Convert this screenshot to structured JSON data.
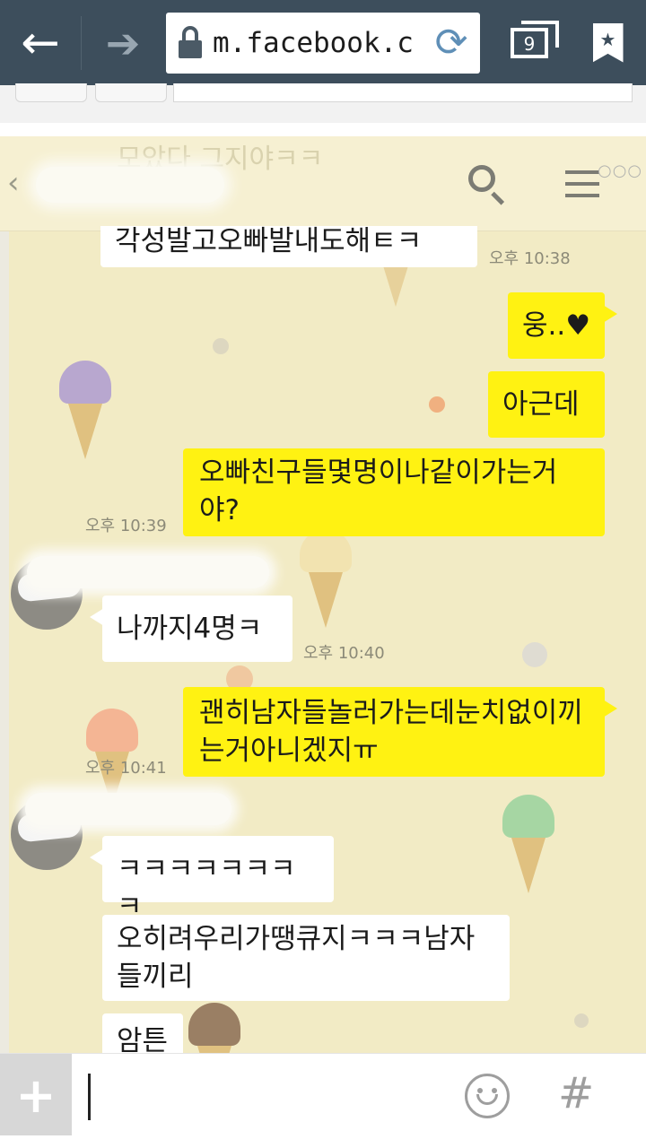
{
  "browser": {
    "url": "m.facebook.c",
    "tab_count": "9",
    "back_icon": "←",
    "forward_icon": "➔",
    "reload_icon": "⟳"
  },
  "chat": {
    "header": {
      "back_icon": "‹",
      "ghost_text": "모았다 그지야ㅋㅋ",
      "dots": "○○○"
    },
    "messages": [
      {
        "side": "left",
        "text": "각성발고오빠발내도해ㅌㅋ",
        "time": "오후 10:38"
      },
      {
        "side": "right",
        "text": "웅..♥"
      },
      {
        "side": "right",
        "text": "아근데"
      },
      {
        "side": "right",
        "text": "오빠친구들몇명이나같이가는거야?",
        "time": "오후 10:39"
      },
      {
        "side": "left",
        "text": "나까지4명ㅋ",
        "time": "오후 10:40"
      },
      {
        "side": "right",
        "text": "괜히남자들놀러가는데눈치없이끼는거아니겠지ㅠ",
        "time": "오후 10:41"
      },
      {
        "side": "left",
        "text": "ㅋㅋㅋㅋㅋㅋㅋㅋ"
      },
      {
        "side": "left",
        "text": "오히려우리가땡큐지ㅋㅋㅋ남자들끼리"
      },
      {
        "side": "left",
        "text": "암튼"
      }
    ]
  },
  "input": {
    "plus_icon": "+",
    "hash_icon": "#"
  },
  "colors": {
    "chrome": "#3d4e5c",
    "chat_bg": "#f2ebc5",
    "yellow_bubble": "#fff212",
    "white_bubble": "#ffffff"
  }
}
